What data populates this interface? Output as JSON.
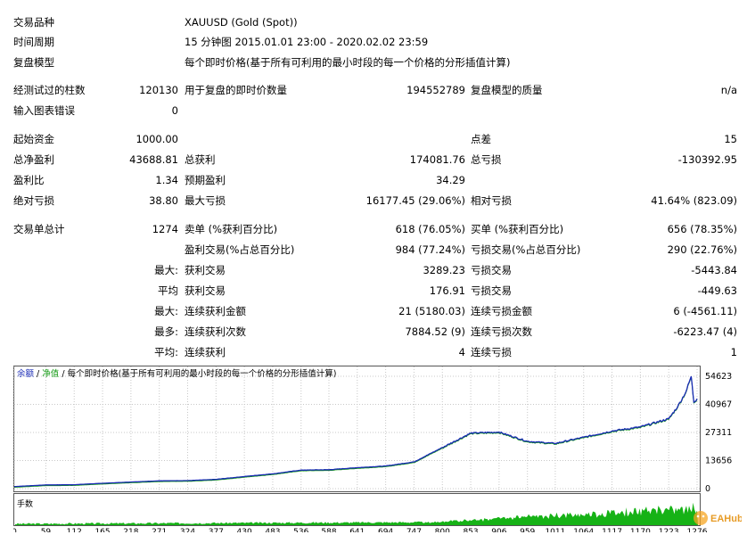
{
  "info": {
    "symbol_label": "交易品种",
    "symbol_value": "XAUUSD (Gold (Spot))",
    "period_label": "时间周期",
    "period_value": "15 分钟图 2015.01.01 23:00 - 2020.02.02 23:59",
    "model_label": "复盘模型",
    "model_value": "每个即时价格(基于所有可利用的最小时段的每一个价格的分形插值计算)"
  },
  "stats": {
    "bars_label": "经测试过的柱数",
    "bars_value": "120130",
    "ticks_label": "用于复盘的即时价数量",
    "ticks_value": "194552789",
    "quality_label": "复盘模型的质量",
    "quality_value": "n/a",
    "errors_label": "输入图表错误",
    "errors_value": "0",
    "deposit_label": "起始资金",
    "deposit_value": "1000.00",
    "spread_label": "点差",
    "spread_value": "15",
    "net_profit_label": "总净盈利",
    "net_profit_value": "43688.81",
    "gross_profit_label": "总获利",
    "gross_profit_value": "174081.76",
    "gross_loss_label": "总亏损",
    "gross_loss_value": "-130392.95",
    "profit_factor_label": "盈利比",
    "profit_factor_value": "1.34",
    "expected_payoff_label": "预期盈利",
    "expected_payoff_value": "34.29",
    "abs_drawdown_label": "绝对亏损",
    "abs_drawdown_value": "38.80",
    "max_drawdown_label": "最大亏损",
    "max_drawdown_value": "16177.45 (29.06%)",
    "rel_drawdown_label": "相对亏损",
    "rel_drawdown_value": "41.64% (823.09)",
    "total_trades_label": "交易单总计",
    "total_trades_value": "1274",
    "short_label": "卖单 (%获利百分比)",
    "short_value": "618 (76.05%)",
    "long_label": "买单 (%获利百分比)",
    "long_value": "656 (78.35%)",
    "profit_trades_label": "盈利交易(%占总百分比)",
    "profit_trades_value": "984 (77.24%)",
    "loss_trades_label": "亏损交易(%占总百分比)",
    "loss_trades_value": "290 (22.76%)",
    "largest_prefix": "最大:",
    "largest_profit_label": "获利交易",
    "largest_profit_value": "3289.23",
    "largest_loss_label": "亏损交易",
    "largest_loss_value": "-5443.84",
    "average_prefix": "平均",
    "average_profit_label": "获利交易",
    "average_profit_value": "176.91",
    "average_loss_label": "亏损交易",
    "average_loss_value": "-449.63",
    "max_prefix": "最大:",
    "max_consec_wins_label": "连续获利金额",
    "max_consec_wins_value": "21 (5180.03)",
    "max_consec_losses_label": "连续亏损金额",
    "max_consec_losses_value": "6 (-4561.11)",
    "maximal_prefix": "最多:",
    "maximal_consec_profit_label": "连续获利次数",
    "maximal_consec_profit_value": "7884.52 (9)",
    "maximal_consec_loss_label": "连续亏损次数",
    "maximal_consec_loss_value": "-6223.47 (4)",
    "avg_prefix": "平均:",
    "avg_consec_wins_label": "连续获利",
    "avg_consec_wins_value": "4",
    "avg_consec_losses_label": "连续亏损",
    "avg_consec_losses_value": "1"
  },
  "chart_legend": {
    "balance": "余额",
    "sep1": "/",
    "equity": "净值",
    "sep2": "/",
    "model": "每个即时价格(基于所有可利用的最小时段的每一个价格的分形插值计算)"
  },
  "lots_label": "手数",
  "watermark": "EAHub",
  "colors": {
    "balance": "#1a2bb5",
    "equity": "#139a13",
    "lots": "#16b216"
  },
  "chart_data": {
    "type": "line",
    "series": [
      {
        "name": "余额",
        "x": [
          0,
          59,
          112,
          165,
          218,
          271,
          324,
          377,
          430,
          483,
          536,
          588,
          641,
          694,
          747,
          800,
          853,
          906,
          959,
          1011,
          1064,
          1117,
          1170,
          1223,
          1240,
          1255,
          1265,
          1270,
          1276
        ],
        "values": [
          1000,
          1800,
          1900,
          2600,
          3200,
          3800,
          3900,
          4500,
          5900,
          7200,
          9000,
          9200,
          10200,
          11000,
          13000,
          20000,
          27000,
          27500,
          23000,
          22000,
          25000,
          28000,
          30000,
          34000,
          40000,
          47000,
          54600,
          42000,
          43689
        ]
      }
    ],
    "x_ticks": [
      "0",
      "59",
      "112",
      "165",
      "218",
      "271",
      "324",
      "377",
      "430",
      "483",
      "536",
      "588",
      "641",
      "694",
      "747",
      "800",
      "853",
      "906",
      "959",
      "1011",
      "1064",
      "1117",
      "1170",
      "1223",
      "1276"
    ],
    "y_ticks": [
      "54623",
      "40967",
      "27311",
      "13656",
      "0"
    ],
    "ylim": [
      0,
      54623
    ],
    "xlim": [
      0,
      1276
    ]
  }
}
